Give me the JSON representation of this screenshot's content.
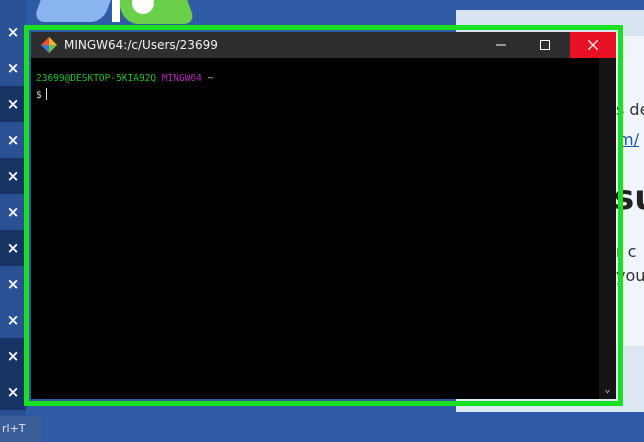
{
  "window": {
    "title": "MINGW64:/c/Users/23699",
    "icon": "git-bash-icon",
    "controls": [
      "minimize-icon",
      "maximize-icon",
      "close-icon"
    ],
    "close_color": "#e81123"
  },
  "terminal": {
    "prompt_user_host": "23699@DESKTOP-5KIA92Q",
    "prompt_env": "MINGW64",
    "prompt_path": "~",
    "prompt_symbol": "$",
    "colors": {
      "user_host": "#19c41e",
      "env": "#b627b6",
      "background": "#000000"
    }
  },
  "background_page": {
    "line1": "s de",
    "line2": "m/",
    "heading": "su",
    "line3": "r c",
    "line4": "you"
  },
  "left_strip": {
    "close_glyph": "×",
    "bottom_text": "rl+T"
  },
  "highlight_color": "#19e021"
}
